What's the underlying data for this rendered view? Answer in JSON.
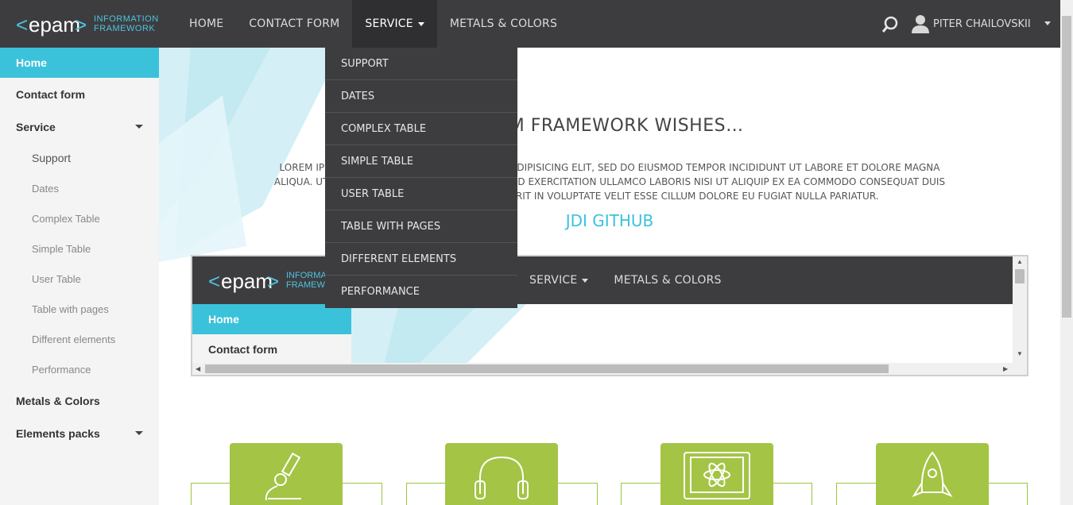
{
  "header": {
    "logo_text": "epam",
    "logo_sub1": "INFORMATION",
    "logo_sub2": "FRAMEWORK",
    "nav": [
      {
        "label": "HOME"
      },
      {
        "label": "CONTACT FORM"
      },
      {
        "label": "SERVICE"
      },
      {
        "label": "METALS & COLORS"
      }
    ],
    "user_name": "PITER CHAILOVSKII"
  },
  "service_menu": [
    "SUPPORT",
    "DATES",
    "COMPLEX TABLE",
    "SIMPLE TABLE",
    "USER TABLE",
    "TABLE WITH PAGES",
    "DIFFERENT ELEMENTS",
    "PERFORMANCE"
  ],
  "sidebar": {
    "home": "Home",
    "contact": "Contact form",
    "service": "Service",
    "service_items": [
      "Support",
      "Dates",
      "Complex Table",
      "Simple Table",
      "User Table",
      "Table with pages",
      "Different elements",
      "Performance"
    ],
    "metals": "Metals & Colors",
    "elements": "Elements packs"
  },
  "main": {
    "title": "EPAM FRAMEWORK WISHES…",
    "text": "LOREM IPSUM DOLOR SIT AMET, CONSECTETUR ADIPISICING ELIT, SED DO EIUSMOD TEMPOR INCIDIDUNT UT LABORE ET DOLORE MAGNA ALIQUA. UT ENIM AD MINIM VENIAM, QUIS NOSTRUD EXERCITATION ULLAMCO LABORIS NISI UT ALIQUIP EX EA COMMODO CONSEQUAT DUIS AUTE IRURE DOLOR IN REPREHENDERIT IN VOLUPTATE VELIT ESSE CILLUM DOLORE EU FUGIAT NULLA PARIATUR.",
    "github": "JDI GITHUB"
  },
  "iframe": {
    "logo_text": "epam",
    "logo_sub1": "INFORMATION",
    "logo_sub2": "FRAMEWORK",
    "nav": [
      {
        "label": "SERVICE"
      },
      {
        "label": "METALS & COLORS"
      }
    ],
    "home": "Home",
    "contact": "Contact form"
  },
  "colors": {
    "accent": "#3bc2db",
    "topbar": "#3d3d3f",
    "card": "#a4c445"
  },
  "icons": [
    "search-icon",
    "user-icon",
    "microscope-icon",
    "headphones-icon",
    "atom-monitor-icon",
    "rocket-icon"
  ]
}
